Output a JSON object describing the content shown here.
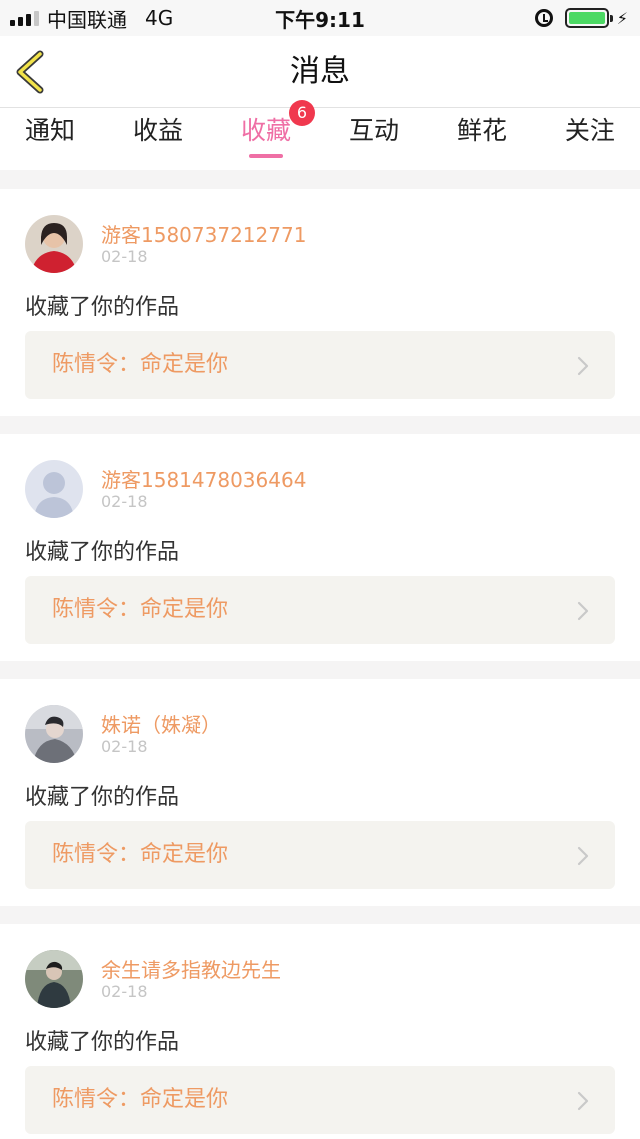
{
  "status_bar": {
    "carrier": "中国联通",
    "network": "4G",
    "time": "下午9:11"
  },
  "nav": {
    "title": "消息",
    "back_icon": "chevron-left-icon"
  },
  "tabs": [
    {
      "label": "通知",
      "active": false
    },
    {
      "label": "收益",
      "active": false
    },
    {
      "label": "收藏",
      "active": true,
      "badge": "6"
    },
    {
      "label": "互动",
      "active": false
    },
    {
      "label": "鲜花",
      "active": false
    },
    {
      "label": "关注",
      "active": false
    }
  ],
  "colors": {
    "accent_pink": "#ef6fa5",
    "name_orange": "#ee9a63",
    "badge_red": "#f0384e"
  },
  "items": [
    {
      "user": "游客1580737212771",
      "date": "02-18",
      "action": "收藏了你的作品",
      "work": "陈情令：命定是你",
      "avatar": "photo-avatar-red"
    },
    {
      "user": "游客1581478036464",
      "date": "02-18",
      "action": "收藏了你的作品",
      "work": "陈情令：命定是你",
      "avatar": "default-avatar"
    },
    {
      "user": "姝诺（姝凝）",
      "date": "02-18",
      "action": "收藏了你的作品",
      "work": "陈情令：命定是你",
      "avatar": "photo-avatar-gray"
    },
    {
      "user": "余生请多指教边先生",
      "date": "02-18",
      "action": "收藏了你的作品",
      "work": "陈情令：命定是你",
      "avatar": "photo-avatar-dark"
    }
  ]
}
